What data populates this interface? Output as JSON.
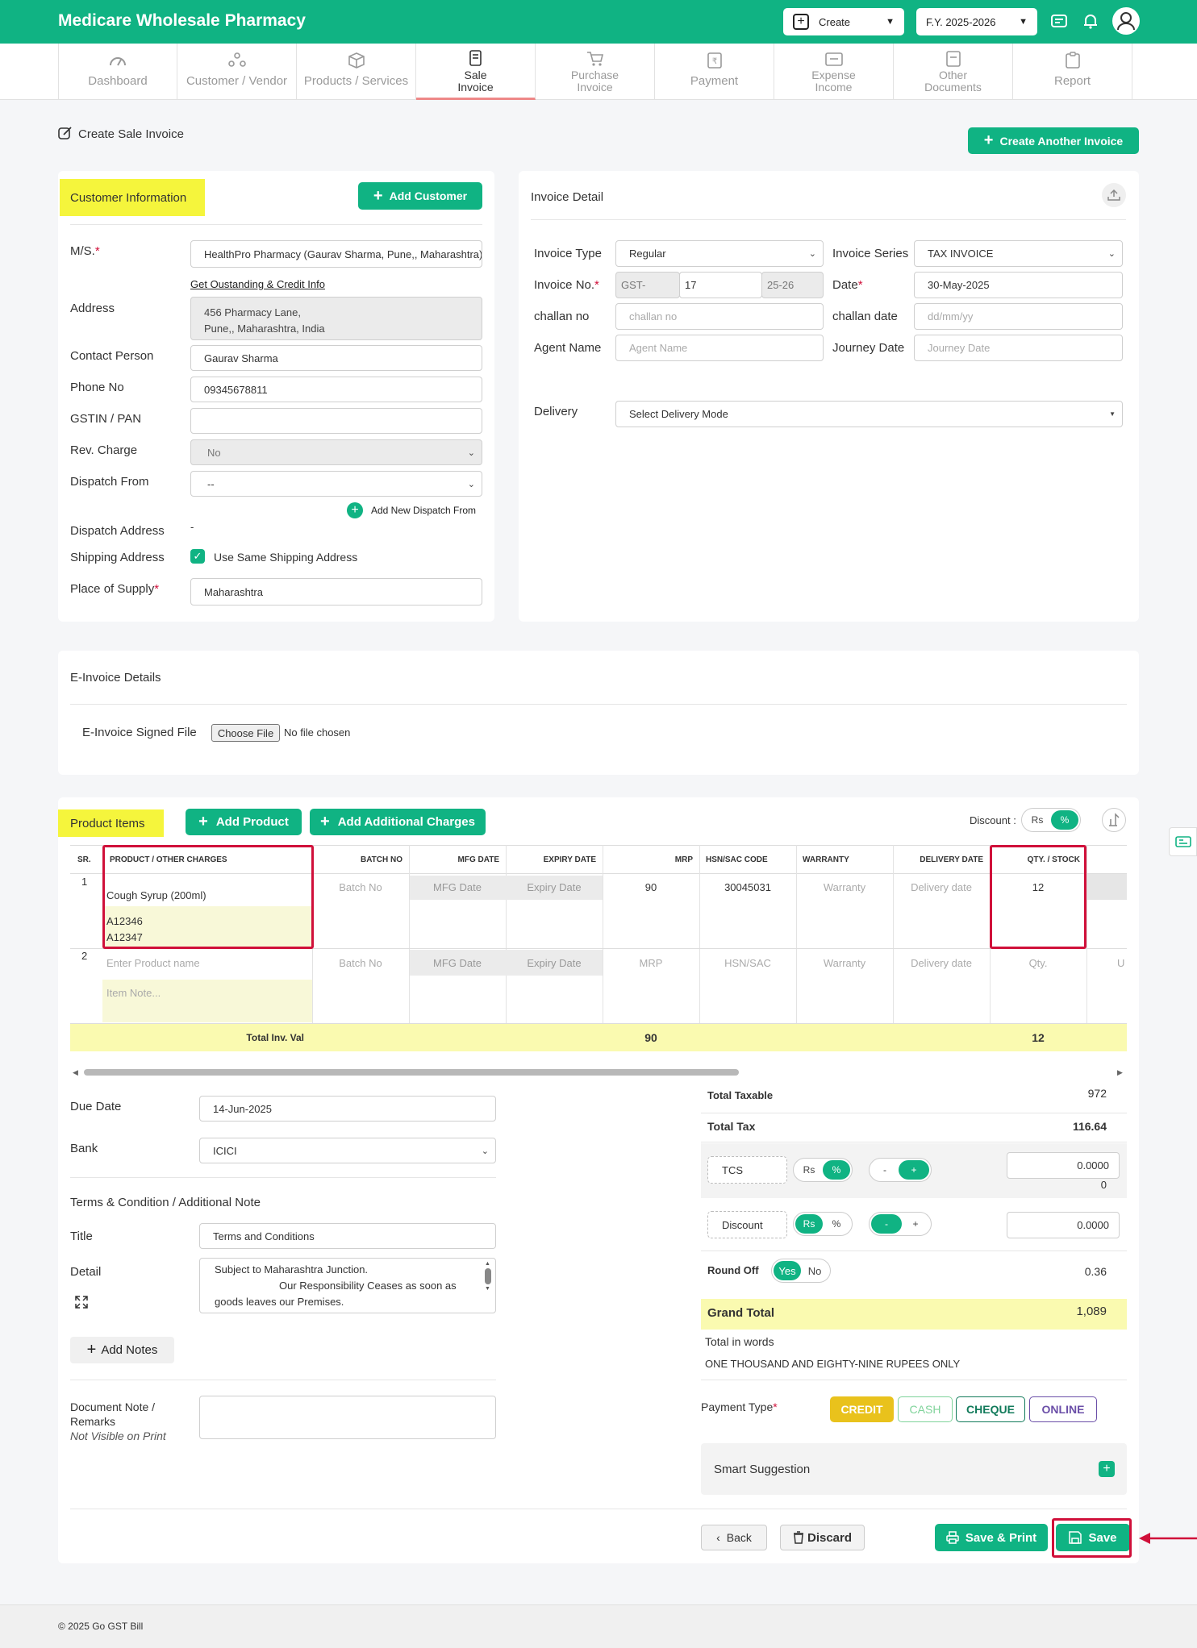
{
  "header": {
    "brand": "Medicare Wholesale Pharmacy",
    "create_label": "Create",
    "fy_label": "F.Y. 2025-2026"
  },
  "nav": [
    {
      "label": "Dashboard"
    },
    {
      "label": "Customer / Vendor"
    },
    {
      "label": "Products / Services"
    },
    {
      "label": "Sale\nInvoice"
    },
    {
      "label": "Purchase\nInvoice"
    },
    {
      "label": "Payment"
    },
    {
      "label": "Expense\nIncome"
    },
    {
      "label": "Other\nDocuments"
    },
    {
      "label": "Report"
    }
  ],
  "page": {
    "title": "Create Sale Invoice",
    "create_another": "Create Another Invoice"
  },
  "customer": {
    "section_title": "Customer Information",
    "add_customer": "Add Customer",
    "ms_label": "M/S.",
    "ms_value": "HealthPro Pharmacy (Gaurav Sharma, Pune,, Maharashtra)",
    "outstanding_link": "Get Oustanding & Credit Info",
    "address_label": "Address",
    "address_line1": "456 Pharmacy Lane,",
    "address_line2": "Pune,, Maharashtra, India",
    "contact_label": "Contact Person",
    "contact_value": "Gaurav Sharma",
    "phone_label": "Phone No",
    "phone_value": "09345678811",
    "gstin_label": "GSTIN / PAN",
    "gstin_value": "",
    "rev_label": "Rev. Charge",
    "rev_value": "No",
    "dispatch_from_label": "Dispatch From",
    "dispatch_from_value": "--",
    "add_dispatch": "Add New Dispatch From",
    "dispatch_address_label": "Dispatch Address",
    "dispatch_address_value": "-",
    "shipping_label": "Shipping Address",
    "same_shipping": "Use Same Shipping Address",
    "supply_label": "Place of Supply",
    "supply_value": "Maharashtra"
  },
  "invoice": {
    "section_title": "Invoice Detail",
    "type_label": "Invoice Type",
    "type_value": "Regular",
    "series_label": "Invoice Series",
    "series_value": "TAX INVOICE",
    "no_label": "Invoice No.",
    "no_prefix": "GST-",
    "no_value": "17",
    "no_suffix": "25-26",
    "date_label": "Date",
    "date_value": "30-May-2025",
    "challan_label": "challan no",
    "challan_ph": "challan no",
    "challan_date_label": "challan date",
    "challan_date_ph": "dd/mm/yy",
    "agent_label": "Agent Name",
    "agent_ph": "Agent Name",
    "journey_label": "Journey Date",
    "journey_ph": "Journey Date",
    "delivery_label": "Delivery",
    "delivery_value": "Select Delivery Mode"
  },
  "einvoice": {
    "title": "E-Invoice Details",
    "signed_label": "E-Invoice Signed File",
    "choose_file": "Choose File",
    "no_file": "No file chosen"
  },
  "products": {
    "section_title": "Product Items",
    "add_product": "Add Product",
    "add_charges": "Add Additional Charges",
    "discount_label": "Discount :",
    "discount_rs": "Rs",
    "discount_pct": "%",
    "columns": [
      "SR.",
      "PRODUCT / OTHER CHARGES",
      "BATCH NO",
      "MFG DATE",
      "EXPIRY DATE",
      "MRP",
      "HSN/SAC CODE",
      "WARRANTY",
      "DELIVERY DATE",
      "QTY. / STOCK"
    ],
    "row1": {
      "sr": "1",
      "product": "Cough Syrup (200ml)",
      "note_line1": "A12346",
      "note_line2": "A12347",
      "batch": "Batch No",
      "mfg": "MFG Date",
      "expiry": "Expiry Date",
      "mrp": "90",
      "hsn": "30045031",
      "warranty": "Warranty",
      "delivery": "Delivery date",
      "qty": "12"
    },
    "row2": {
      "sr": "2",
      "product_ph": "Enter Product name",
      "note_ph": "Item Note...",
      "batch": "Batch No",
      "mfg": "MFG Date",
      "expiry": "Expiry Date",
      "mrp": "MRP",
      "hsn": "HSN/SAC",
      "warranty": "Warranty",
      "delivery": "Delivery date",
      "qty": "Qty.",
      "unit": "U"
    },
    "total_label": "Total Inv. Val",
    "total_mrp": "90",
    "total_qty": "12"
  },
  "bottom": {
    "due_label": "Due Date",
    "due_value": "14-Jun-2025",
    "bank_label": "Bank",
    "bank_value": "ICICI",
    "terms_heading": "Terms & Condition / Additional Note",
    "title_label": "Title",
    "title_value": "Terms and Conditions",
    "detail_label": "Detail",
    "detail_line1": "Subject to Maharashtra Junction.",
    "detail_line2": "Our Responsibility Ceases as soon as",
    "detail_line3": "goods leaves our Premises.",
    "add_notes": "Add Notes",
    "doc_note_label1": "Document Note /",
    "doc_note_label2": "Remarks",
    "doc_note_hint": "Not Visible on Print"
  },
  "totals": {
    "taxable_label": "Total Taxable",
    "taxable_value": "972",
    "tax_label": "Total Tax",
    "tax_value": "116.64",
    "tcs_label": "TCS",
    "tcs_rs": "Rs",
    "tcs_pct": "%",
    "tcs_minus": "-",
    "tcs_plus": "+",
    "tcs_input": "0.0000",
    "tcs_value": "0",
    "discount_label": "Discount",
    "disc_rs": "Rs",
    "disc_pct": "%",
    "disc_minus": "-",
    "disc_plus": "+",
    "disc_input": "0.0000",
    "roundoff_label": "Round Off",
    "round_yes": "Yes",
    "round_no": "No",
    "roundoff_value": "0.36",
    "grand_label": "Grand Total",
    "grand_value": "1,089",
    "words_label": "Total in words",
    "words_value": "ONE THOUSAND AND EIGHTY-NINE RUPEES ONLY",
    "payment_label": "Payment Type",
    "pay_credit": "CREDIT",
    "pay_cash": "CASH",
    "pay_cheque": "CHEQUE",
    "pay_online": "ONLINE",
    "smart_label": "Smart Suggestion"
  },
  "actions": {
    "back": "Back",
    "discard": "Discard",
    "save_print": "Save & Print",
    "save": "Save"
  },
  "footer": {
    "copyright": "© 2025 Go GST Bill"
  },
  "colors": {
    "primary": "#10b383",
    "highlight": "#f5f53c",
    "annotation": "#d0103a",
    "credit": "#e9c21c"
  }
}
